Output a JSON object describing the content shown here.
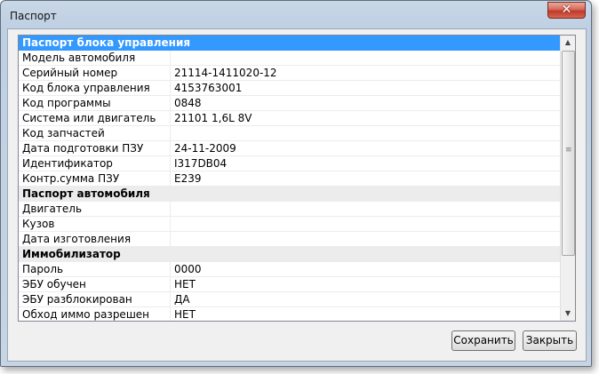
{
  "window": {
    "title": "Паспорт",
    "close_glyph": "✕"
  },
  "table": {
    "rows": [
      {
        "type": "section",
        "label": "Паспорт блока управления",
        "selected": true
      },
      {
        "type": "row",
        "label": "Модель автомобиля",
        "value": ""
      },
      {
        "type": "row",
        "label": "Серийный номер",
        "value": "21114-1411020-12"
      },
      {
        "type": "row",
        "label": "Код блока управления",
        "value": "4153763001"
      },
      {
        "type": "row",
        "label": "Код программы",
        "value": "0848"
      },
      {
        "type": "row",
        "label": "Система или двигатель",
        "value": "21101 1,6L 8V"
      },
      {
        "type": "row",
        "label": "Код запчастей",
        "value": ""
      },
      {
        "type": "row",
        "label": "Дата подготовки ПЗУ",
        "value": "24-11-2009"
      },
      {
        "type": "row",
        "label": "Идентификатор",
        "value": "I317DB04"
      },
      {
        "type": "row",
        "label": "Контр.сумма ПЗУ",
        "value": "E239"
      },
      {
        "type": "section",
        "label": "Паспорт автомобиля",
        "selected": false
      },
      {
        "type": "row",
        "label": "Двигатель",
        "value": ""
      },
      {
        "type": "row",
        "label": "Кузов",
        "value": ""
      },
      {
        "type": "row",
        "label": "Дата изготовления",
        "value": ""
      },
      {
        "type": "section",
        "label": "Иммобилизатор",
        "selected": false
      },
      {
        "type": "row",
        "label": "Пароль",
        "value": "0000"
      },
      {
        "type": "row",
        "label": "ЭБУ обучен",
        "value": "НЕТ"
      },
      {
        "type": "row",
        "label": "ЭБУ разблокирован",
        "value": "ДА"
      },
      {
        "type": "row",
        "label": "Обход иммо разрешен",
        "value": "НЕТ"
      }
    ]
  },
  "buttons": {
    "save_label": "Сохранить",
    "close_label": "Закрыть"
  },
  "colors": {
    "selection": "#3399ff",
    "section_bg": "#ececec"
  }
}
